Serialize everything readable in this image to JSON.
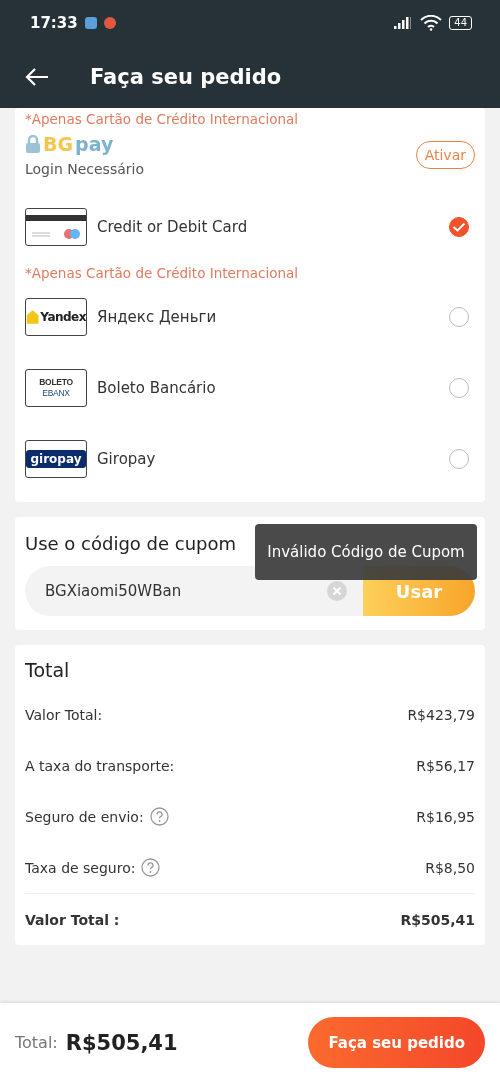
{
  "status_bar": {
    "time": "17:33",
    "battery": "44"
  },
  "header": {
    "title": "Faça seu pedido"
  },
  "payment_items": [
    {
      "kind": "note",
      "text": "*Apenas Cartão de Crédito  Internacional"
    },
    {
      "kind": "wallet",
      "logo": [
        "BG",
        "pay"
      ],
      "subtitle": "Login Necessário",
      "action": "Ativar"
    },
    {
      "kind": "method",
      "logo": {
        "kind": "card"
      },
      "label": "Credit or Debit Card",
      "selected": true
    },
    {
      "kind": "note",
      "text": "*Apenas Cartão de Crédito  Internacional"
    },
    {
      "kind": "method",
      "logo": {
        "kind": "yandex",
        "text": [
          "Yandex"
        ]
      },
      "label": "Яндекс Деньги",
      "selected": false
    },
    {
      "kind": "method",
      "logo": {
        "kind": "boleto",
        "text": [
          "BOLETO",
          "EBANX"
        ]
      },
      "label": "Boleto Bancário",
      "selected": false
    },
    {
      "kind": "method",
      "logo": {
        "kind": "giropay",
        "text": [
          "giropay"
        ]
      },
      "label": "Giropay",
      "selected": false
    }
  ],
  "coupon": {
    "title": "Use o código de cupom",
    "value": "BGXiaomi50WBan",
    "button": "Usar"
  },
  "toast": "Inválido Código de Cupom",
  "totals": {
    "title": "Total",
    "rows": [
      {
        "label": "Valor Total:",
        "value": "R$423,79",
        "help": false,
        "kind": "line"
      },
      {
        "label": "A taxa do transporte:",
        "value": "R$56,17",
        "help": false,
        "kind": "line"
      },
      {
        "label": "Seguro de envio:",
        "value": "R$16,95",
        "help": true,
        "kind": "line"
      },
      {
        "label": "Taxa de seguro:",
        "value": "R$8,50",
        "help": true,
        "kind": "line"
      },
      {
        "label": "Valor Total :",
        "value": "R$505,41",
        "help": false,
        "kind": "total"
      }
    ]
  },
  "footer": {
    "label": "Total:",
    "amount": "R$505,41",
    "button": "Faça seu pedido"
  }
}
